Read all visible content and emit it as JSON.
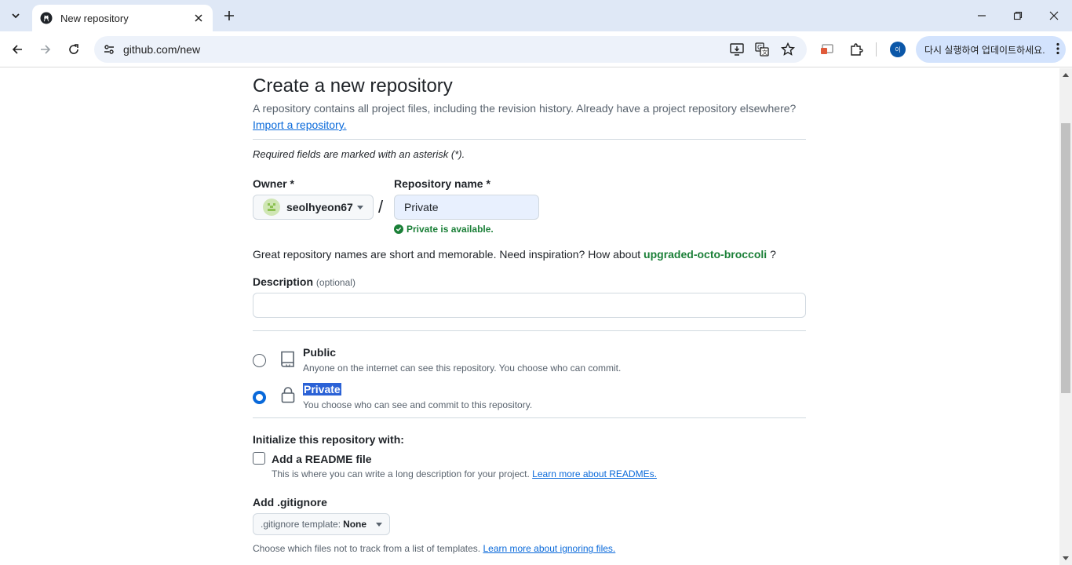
{
  "browser": {
    "tab_title": "New repository",
    "url": "github.com/new",
    "update_label": "다시 실행하여 업데이트하세요.",
    "profile_initial": "이"
  },
  "page": {
    "heading": "Create a new repository",
    "intro": "A repository contains all project files, including the revision history. Already have a project repository elsewhere?",
    "import_link": "Import a repository.",
    "required_note": "Required fields are marked with an asterisk (*).",
    "owner_label": "Owner *",
    "owner_value": "seolhyeon67",
    "slash": "/",
    "repo_label": "Repository name *",
    "repo_value": "Private",
    "availability": "Private is available.",
    "suggest_prefix": "Great repository names are short and memorable. Need inspiration? How about",
    "suggest_name": "upgraded-octo-broccoli",
    "suggest_suffix": "?",
    "description_label": "Description",
    "description_optional": "(optional)",
    "visibility": {
      "public_title": "Public",
      "public_desc": "Anyone on the internet can see this repository. You choose who can commit.",
      "private_title": "Private",
      "private_desc": "You choose who can see and commit to this repository.",
      "selected": "private"
    },
    "init_label": "Initialize this repository with:",
    "readme_label": "Add a README file",
    "readme_desc": "This is where you can write a long description for your project.",
    "readme_link": "Learn more about READMEs.",
    "gitignore_label": "Add .gitignore",
    "gitignore_prefix": ".gitignore template:",
    "gitignore_value": "None",
    "gitignore_desc": "Choose which files not to track from a list of templates.",
    "gitignore_link": "Learn more about ignoring files."
  },
  "colors": {
    "accent": "#0969da",
    "success": "#1a7f37",
    "chrome_bg": "#dfe8f6"
  }
}
